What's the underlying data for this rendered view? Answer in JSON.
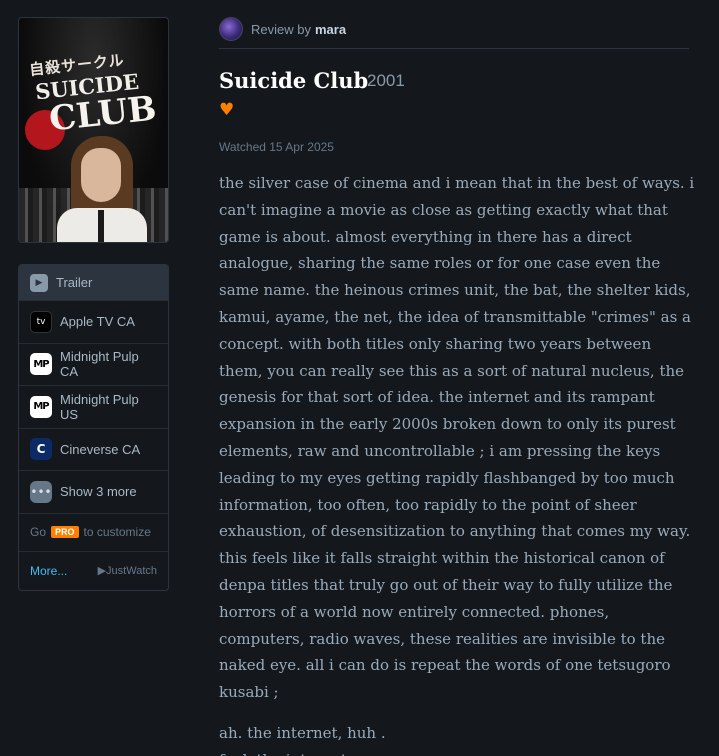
{
  "poster": {
    "jp_title": "自殺サークル",
    "title_top": "SUICIDE",
    "title_bottom": "CLUB"
  },
  "watch_panel": {
    "trailer": "Trailer",
    "services": [
      {
        "label": "Apple TV CA",
        "icon": "apple-tv-icon",
        "glyph": "tv"
      },
      {
        "label": "Midnight Pulp CA",
        "icon": "midnight-pulp-icon",
        "glyph": "MP"
      },
      {
        "label": "Midnight Pulp US",
        "icon": "midnight-pulp-icon",
        "glyph": "MP"
      },
      {
        "label": "Cineverse CA",
        "icon": "cineverse-icon",
        "glyph": "C"
      }
    ],
    "show_more": "Show 3 more",
    "go_prefix": "Go",
    "pro_badge": "PRO",
    "go_suffix": "to customize",
    "more_link": "More...",
    "provider": "JustWatch"
  },
  "review": {
    "by_label": "Review by",
    "author": "mara",
    "film_title": "Suicide Club",
    "year": "2001",
    "liked": true,
    "watched": "Watched 15 Apr 2025",
    "paragraph1": "the silver case of cinema and i mean that in the best of ways. i can't imagine a movie as close as getting exactly what that game is about. almost everything in there has a direct analogue, sharing the same roles or for one case even the same name. the heinous crimes unit, the bat, the shelter kids, kamui, ayame, the net, the idea of transmittable \"crimes\" as a concept. with both titles only sharing two years between them, you can really see this as a sort of natural nucleus, the genesis for that sort of idea. the internet and its rampant expansion in the early 2000s broken down to only its purest elements, raw and uncontrollable ; i am pressing the keys leading to my eyes getting rapidly flashbanged by too much information, too often, too rapidly to the point of sheer exhaustion, of desensitization to anything that comes my way. this feels like it falls straight within the historical canon of denpa titles that truly go out of their way to fully utilize the horrors of a world now entirely connected. phones, computers, radio waves, these realities are invisible to the naked eye. all i can do is repeat the words of one tetsugoro kusabi ;",
    "line2a": "ah. the internet, huh .",
    "line2b": "fuck the internet"
  },
  "colors": {
    "background": "#14181c",
    "accent_orange": "#ff8000",
    "link_blue": "#40bcf4"
  }
}
